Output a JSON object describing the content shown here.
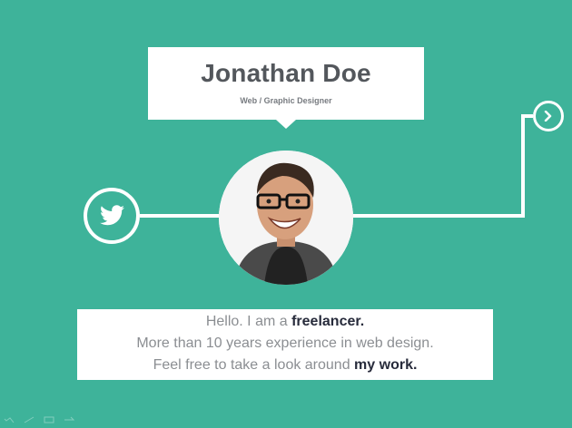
{
  "profile": {
    "name": "Jonathan Doe",
    "role": "Web / Graphic Designer"
  },
  "intro": {
    "line1_prefix": "Hello. I am a ",
    "line1_emph": "freelancer.",
    "line2": "More than 10 years experience in web design.",
    "line3_prefix": "Feel free to take a look around ",
    "line3_emph": "my work."
  },
  "icons": {
    "social": "twitter-icon",
    "navigation": "chevron-right-icon"
  },
  "colors": {
    "background": "#3eb39a",
    "card": "#ffffff",
    "name_text": "#53575c",
    "emphasis_text": "#272b3b",
    "body_text": "#8b8e92"
  }
}
